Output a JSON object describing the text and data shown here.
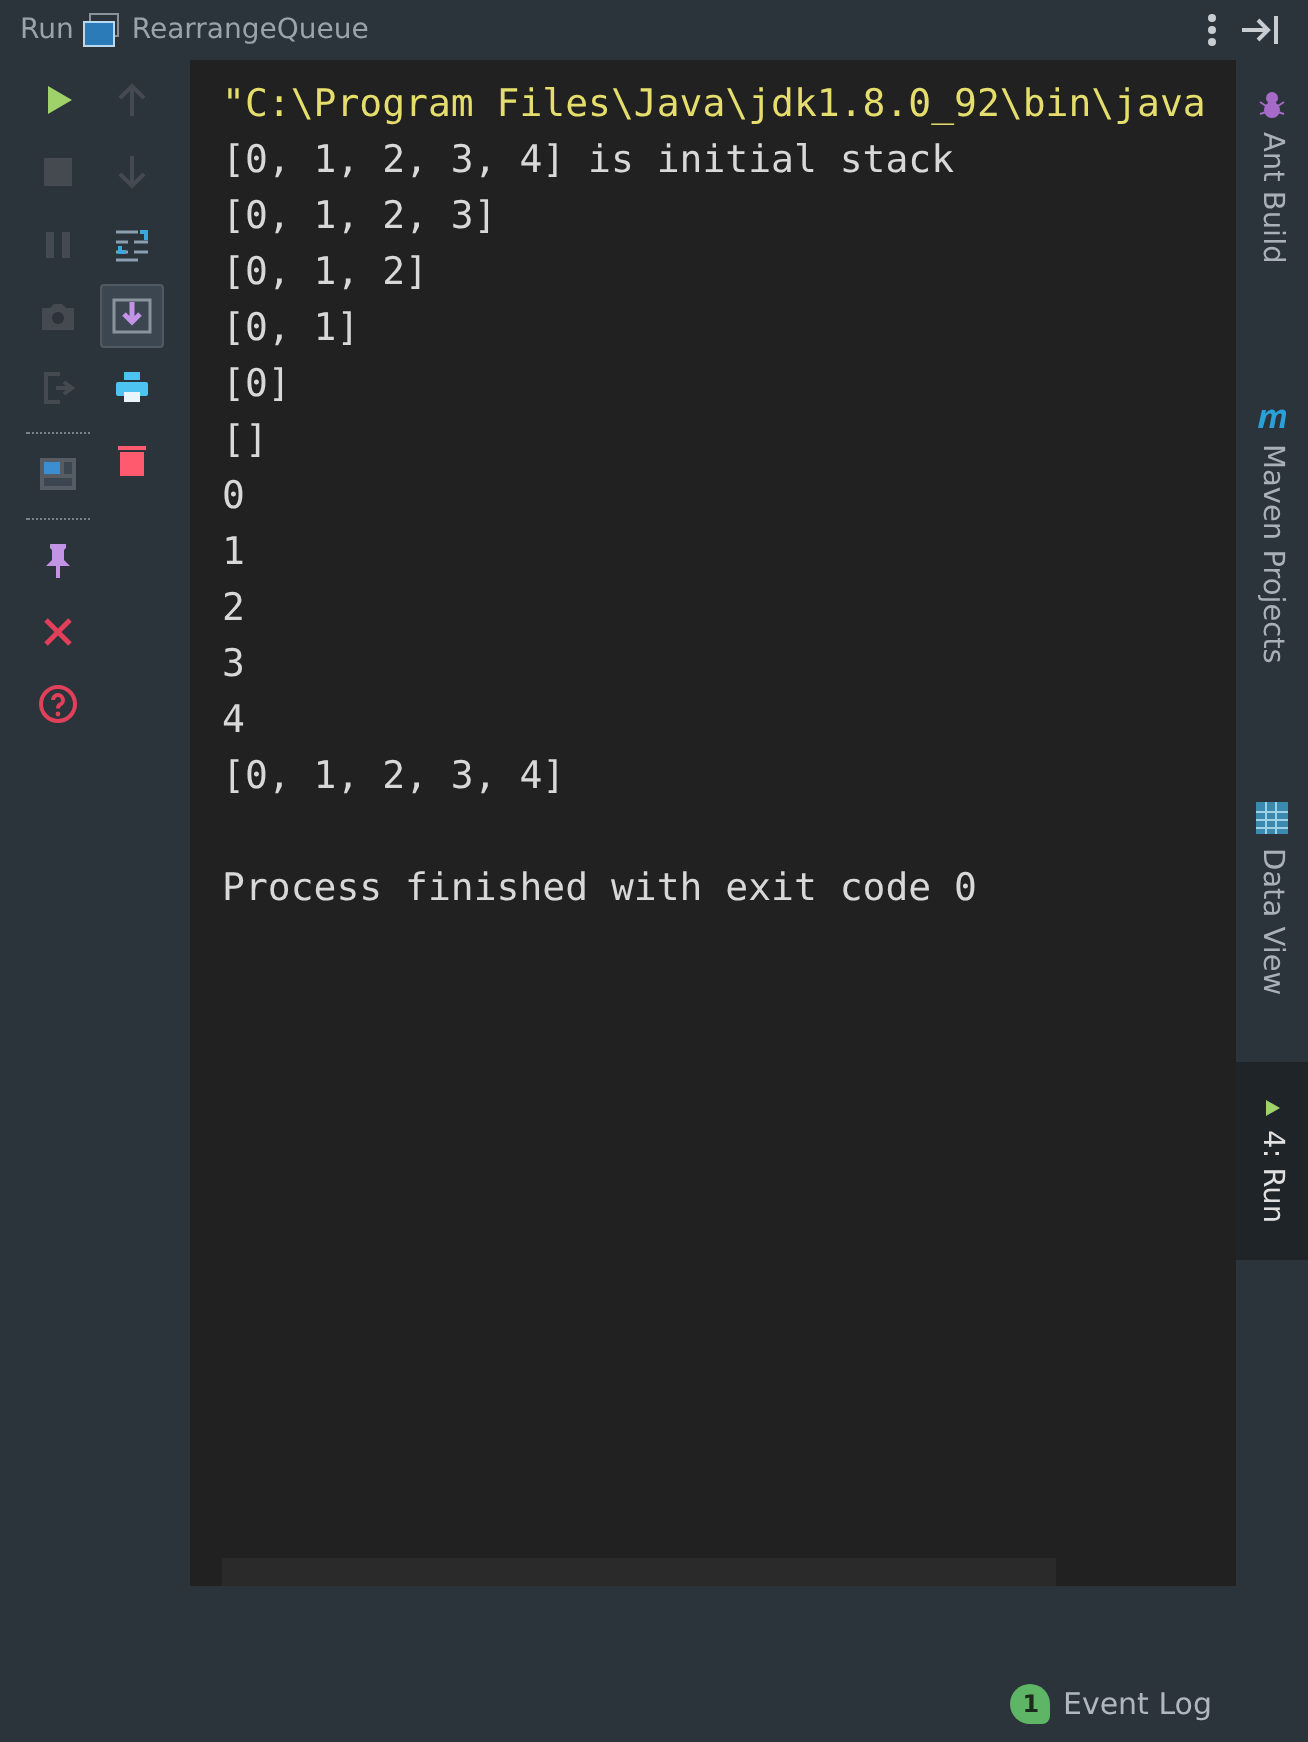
{
  "header": {
    "title": "Run",
    "tab": "RearrangeQueue"
  },
  "toolbar_left": [
    {
      "kind": "run",
      "disabled": false
    },
    {
      "kind": "stop",
      "disabled": true
    },
    {
      "kind": "pause",
      "disabled": true
    },
    {
      "kind": "camera",
      "disabled": true
    },
    {
      "kind": "exit",
      "disabled": true
    },
    {
      "kind": "separator"
    },
    {
      "kind": "layout",
      "disabled": false
    },
    {
      "kind": "separator"
    },
    {
      "kind": "pin",
      "disabled": false
    },
    {
      "kind": "close",
      "disabled": false
    },
    {
      "kind": "help",
      "disabled": false
    }
  ],
  "toolbar_right": [
    {
      "kind": "up",
      "disabled": true,
      "on": false
    },
    {
      "kind": "down",
      "disabled": true,
      "on": false
    },
    {
      "kind": "wrap",
      "disabled": false,
      "on": false
    },
    {
      "kind": "scroll",
      "disabled": false,
      "on": true
    },
    {
      "kind": "print",
      "disabled": false,
      "on": false
    },
    {
      "kind": "trash",
      "disabled": false,
      "on": false
    }
  ],
  "console": [
    {
      "kind": "command",
      "text": "\"C:\\Program Files\\Java\\jdk1.8.0_92\\bin\\java"
    },
    {
      "kind": "output",
      "text": "[0, 1, 2, 3, 4] is initial stack"
    },
    {
      "kind": "output",
      "text": "[0, 1, 2, 3]"
    },
    {
      "kind": "output",
      "text": "[0, 1, 2]"
    },
    {
      "kind": "output",
      "text": "[0, 1]"
    },
    {
      "kind": "output",
      "text": "[0]"
    },
    {
      "kind": "output",
      "text": "[]"
    },
    {
      "kind": "output",
      "text": "0"
    },
    {
      "kind": "output",
      "text": "1"
    },
    {
      "kind": "output",
      "text": "2"
    },
    {
      "kind": "output",
      "text": "3"
    },
    {
      "kind": "output",
      "text": "4"
    },
    {
      "kind": "output",
      "text": "[0, 1, 2, 3, 4]"
    },
    {
      "kind": "blank"
    },
    {
      "kind": "output",
      "text": "Process finished with exit code 0"
    }
  ],
  "side_tabs": [
    {
      "kind": "ant",
      "label": "Ant Build",
      "selected": false
    },
    {
      "kind": "maven",
      "label": "Maven Projects",
      "selected": false
    },
    {
      "kind": "data",
      "label": "Data View",
      "selected": false
    },
    {
      "kind": "run",
      "label": "4: Run",
      "selected": true
    }
  ],
  "status_bar": {
    "badge": "1",
    "label": "Event Log"
  }
}
